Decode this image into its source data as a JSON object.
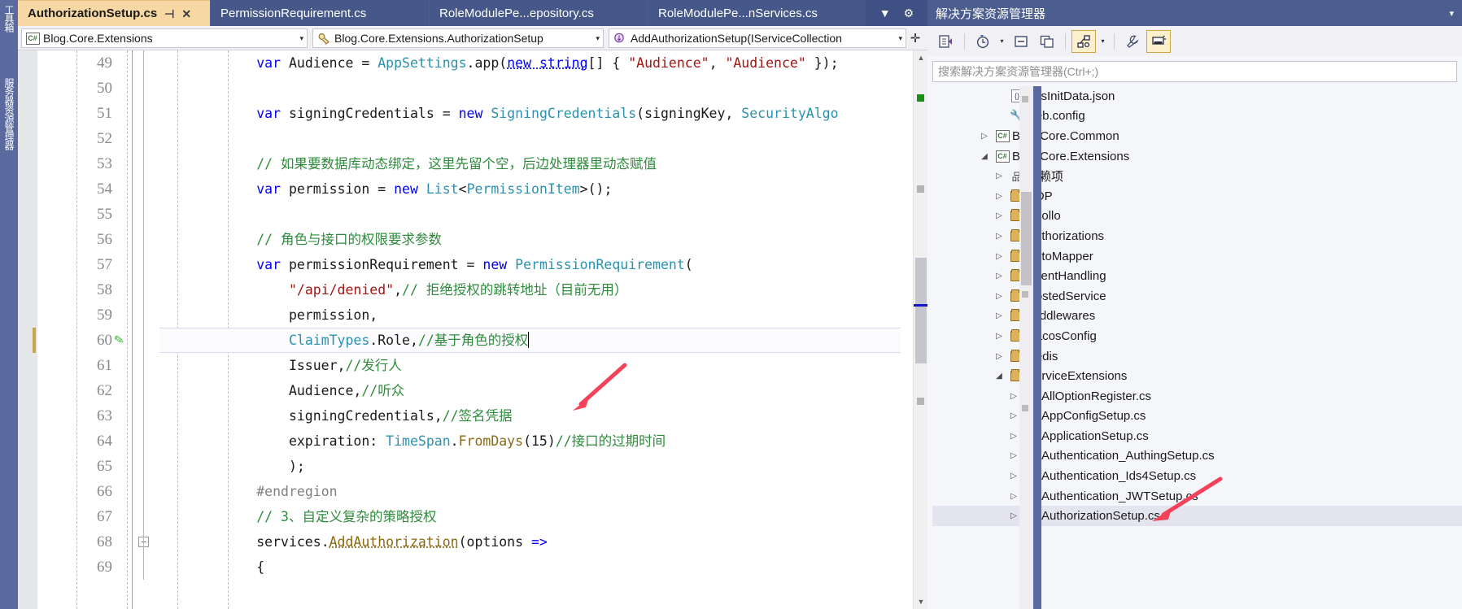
{
  "left_dock": {
    "items": [
      {
        "label": "工具箱",
        "name": "toolbox"
      },
      {
        "label": "服务器资源管理器",
        "name": "server-explorer"
      }
    ]
  },
  "editor": {
    "tabs": [
      {
        "label": "AuthorizationSetup.cs",
        "active": true,
        "pin": "⊣",
        "close": "✕"
      },
      {
        "label": "PermissionRequirement.cs",
        "active": false
      },
      {
        "label": "RoleModulePe...epository.cs",
        "active": false
      },
      {
        "label": "RoleModulePe...nServices.cs",
        "active": false
      }
    ],
    "tabstrip_buttons": [
      {
        "name": "tab-list-dropdown",
        "glyph": "▼"
      },
      {
        "name": "tab-settings-gear",
        "glyph": "⚙"
      }
    ],
    "navbar": {
      "project": "Blog.Core.Extensions",
      "project_icon": "csharp-project-icon",
      "type": "Blog.Core.Extensions.AuthorizationSetup",
      "type_icon": "class-icon",
      "member": "AddAuthorizationSetup(IServiceCollection",
      "member_icon": "method-icon",
      "caret": "▾",
      "split_glyph": "✛"
    },
    "scrollbar": {
      "up_glyph": "▲",
      "down_glyph": "▼"
    },
    "lines": [
      {
        "no": "49",
        "edited": false,
        "tokens": [
          {
            "t": "            ",
            "c": "t-id"
          },
          {
            "t": "var",
            "c": "t-kw"
          },
          {
            "t": " Audience ",
            "c": "t-id"
          },
          {
            "t": "= ",
            "c": "t-id"
          },
          {
            "t": "AppSettings",
            "c": "t-type"
          },
          {
            "t": ".app(",
            "c": "t-id"
          },
          {
            "t": "new string",
            "c": "t-kw t-un"
          },
          {
            "t": "[] { ",
            "c": "t-id"
          },
          {
            "t": "\"Audience\"",
            "c": "t-str"
          },
          {
            "t": ", ",
            "c": "t-id"
          },
          {
            "t": "\"Audience\"",
            "c": "t-str"
          },
          {
            "t": " });",
            "c": "t-id"
          }
        ]
      },
      {
        "no": "50",
        "edited": false,
        "tokens": []
      },
      {
        "no": "51",
        "edited": false,
        "tokens": [
          {
            "t": "            ",
            "c": "t-id"
          },
          {
            "t": "var",
            "c": "t-kw"
          },
          {
            "t": " signingCredentials ",
            "c": "t-id"
          },
          {
            "t": "= ",
            "c": "t-id"
          },
          {
            "t": "new",
            "c": "t-kw"
          },
          {
            "t": " ",
            "c": "t-id"
          },
          {
            "t": "SigningCredentials",
            "c": "t-type"
          },
          {
            "t": "(signingKey, ",
            "c": "t-id"
          },
          {
            "t": "SecurityAlgo",
            "c": "t-type"
          }
        ]
      },
      {
        "no": "52",
        "edited": false,
        "tokens": []
      },
      {
        "no": "53",
        "edited": false,
        "tokens": [
          {
            "t": "            ",
            "c": "t-id"
          },
          {
            "t": "// 如果要数据库动态绑定，这里先留个空，后边处理器里动态赋值",
            "c": "t-cmt"
          }
        ]
      },
      {
        "no": "54",
        "edited": false,
        "tokens": [
          {
            "t": "            ",
            "c": "t-id"
          },
          {
            "t": "var",
            "c": "t-kw"
          },
          {
            "t": " permission ",
            "c": "t-id"
          },
          {
            "t": "= ",
            "c": "t-id"
          },
          {
            "t": "new",
            "c": "t-kw"
          },
          {
            "t": " ",
            "c": "t-id"
          },
          {
            "t": "List",
            "c": "t-type"
          },
          {
            "t": "<",
            "c": "t-id"
          },
          {
            "t": "PermissionItem",
            "c": "t-type"
          },
          {
            "t": ">();",
            "c": "t-id"
          }
        ]
      },
      {
        "no": "55",
        "edited": false,
        "tokens": []
      },
      {
        "no": "56",
        "edited": false,
        "tokens": [
          {
            "t": "            ",
            "c": "t-id"
          },
          {
            "t": "// 角色与接口的权限要求参数",
            "c": "t-cmt"
          }
        ]
      },
      {
        "no": "57",
        "edited": false,
        "tokens": [
          {
            "t": "            ",
            "c": "t-id"
          },
          {
            "t": "var",
            "c": "t-kw"
          },
          {
            "t": " permissionRequirement ",
            "c": "t-id"
          },
          {
            "t": "= ",
            "c": "t-id"
          },
          {
            "t": "new",
            "c": "t-kw"
          },
          {
            "t": " ",
            "c": "t-id"
          },
          {
            "t": "PermissionRequirement",
            "c": "t-type"
          },
          {
            "t": "(",
            "c": "t-id"
          }
        ]
      },
      {
        "no": "58",
        "edited": false,
        "tokens": [
          {
            "t": "                ",
            "c": "t-id"
          },
          {
            "t": "\"/api/denied\"",
            "c": "t-str"
          },
          {
            "t": ",",
            "c": "t-id"
          },
          {
            "t": "// 拒绝授权的跳转地址（目前无用）",
            "c": "t-cmt"
          }
        ]
      },
      {
        "no": "59",
        "edited": false,
        "tokens": [
          {
            "t": "                permission,",
            "c": "t-id"
          }
        ]
      },
      {
        "no": "60",
        "edited": true,
        "current": true,
        "caret": true,
        "tokens": [
          {
            "t": "                ",
            "c": "t-id"
          },
          {
            "t": "ClaimTypes",
            "c": "t-type"
          },
          {
            "t": ".Role,",
            "c": "t-id"
          },
          {
            "t": "//基于角色的授权",
            "c": "t-cmt"
          }
        ]
      },
      {
        "no": "61",
        "edited": false,
        "tokens": [
          {
            "t": "                Issuer,",
            "c": "t-id"
          },
          {
            "t": "//发行人",
            "c": "t-cmt"
          }
        ]
      },
      {
        "no": "62",
        "edited": false,
        "tokens": [
          {
            "t": "                Audience,",
            "c": "t-id"
          },
          {
            "t": "//听众",
            "c": "t-cmt"
          }
        ]
      },
      {
        "no": "63",
        "edited": false,
        "tokens": [
          {
            "t": "                signingCredentials,",
            "c": "t-id"
          },
          {
            "t": "//签名凭据",
            "c": "t-cmt"
          }
        ]
      },
      {
        "no": "64",
        "edited": false,
        "tokens": [
          {
            "t": "                expiration: ",
            "c": "t-id"
          },
          {
            "t": "TimeSpan",
            "c": "t-type"
          },
          {
            "t": ".",
            "c": "t-id"
          },
          {
            "t": "FromDays",
            "c": "t-mem"
          },
          {
            "t": "(",
            "c": "t-id"
          },
          {
            "t": "15",
            "c": "t-num"
          },
          {
            "t": ")",
            "c": "t-id"
          },
          {
            "t": "//接口的过期时间",
            "c": "t-cmt"
          }
        ]
      },
      {
        "no": "65",
        "edited": false,
        "tokens": [
          {
            "t": "                );",
            "c": "t-id"
          }
        ]
      },
      {
        "no": "66",
        "edited": false,
        "tokens": [
          {
            "t": "            ",
            "c": "t-id"
          },
          {
            "t": "#endregion",
            "c": "t-pp"
          }
        ]
      },
      {
        "no": "67",
        "edited": false,
        "tokens": [
          {
            "t": "            ",
            "c": "t-id"
          },
          {
            "t": "// 3、自定义复杂的策略授权",
            "c": "t-cmt"
          }
        ]
      },
      {
        "no": "68",
        "edited": false,
        "fold": "−",
        "tokens": [
          {
            "t": "            services",
            "c": "t-id"
          },
          {
            "t": ".",
            "c": "t-id"
          },
          {
            "t": "AddAuthorization",
            "c": "t-mem t-un"
          },
          {
            "t": "(options ",
            "c": "t-id"
          },
          {
            "t": "=>",
            "c": "t-kw"
          }
        ]
      },
      {
        "no": "69",
        "edited": false,
        "tokens": [
          {
            "t": "            {",
            "c": "t-id"
          }
        ]
      }
    ]
  },
  "solution_explorer": {
    "title": "解决方案资源管理器",
    "title_caret": "▾",
    "toolbar": [
      {
        "name": "home-view-button",
        "glyph": "⊲",
        "hot": false
      },
      {
        "name": "pending-changes-button",
        "glyph": "◔",
        "hot": false,
        "caret": true
      },
      {
        "name": "collapse-all-button",
        "glyph": "⊟",
        "hot": false
      },
      {
        "name": "show-all-files-button",
        "glyph": "❐",
        "hot": false
      },
      {
        "name": "view-selector-button",
        "glyph": "⚯",
        "hot": true,
        "caret": true
      },
      {
        "name": "properties-button",
        "glyph": "🔧",
        "hot": false
      },
      {
        "name": "preview-selected-items-button",
        "glyph": "▤",
        "hot": true
      }
    ],
    "search_placeholder": "搜索解决方案资源管理器(Ctrl+;)",
    "tree": [
      {
        "label": "SysInitData.json",
        "icon": "json-file-icon",
        "indent": 4,
        "expander": ""
      },
      {
        "label": "web.config",
        "icon": "config-file-icon",
        "indent": 4,
        "expander": ""
      },
      {
        "label": "Blog.Core.Common",
        "icon": "csharp-project-icon",
        "indent": 3,
        "expander": "▷"
      },
      {
        "label": "Blog.Core.Extensions",
        "icon": "csharp-project-icon",
        "indent": 3,
        "expander": "◢"
      },
      {
        "label": "依赖项",
        "icon": "dependencies-icon",
        "indent": 4,
        "expander": "▷"
      },
      {
        "label": "AOP",
        "icon": "folder-icon",
        "indent": 4,
        "expander": "▷"
      },
      {
        "label": "Apollo",
        "icon": "folder-icon",
        "indent": 4,
        "expander": "▷"
      },
      {
        "label": "Authorizations",
        "icon": "folder-icon",
        "indent": 4,
        "expander": "▷"
      },
      {
        "label": "AutoMapper",
        "icon": "folder-icon",
        "indent": 4,
        "expander": "▷"
      },
      {
        "label": "EventHandling",
        "icon": "folder-icon",
        "indent": 4,
        "expander": "▷"
      },
      {
        "label": "HostedService",
        "icon": "folder-icon",
        "indent": 4,
        "expander": "▷"
      },
      {
        "label": "Middlewares",
        "icon": "folder-icon",
        "indent": 4,
        "expander": "▷"
      },
      {
        "label": "NacosConfig",
        "icon": "folder-icon",
        "indent": 4,
        "expander": "▷"
      },
      {
        "label": "Redis",
        "icon": "folder-icon",
        "indent": 4,
        "expander": "▷"
      },
      {
        "label": "ServiceExtensions",
        "icon": "folder-icon",
        "indent": 4,
        "expander": "◢"
      },
      {
        "label": "AllOptionRegister.cs",
        "icon": "csharp-file-icon",
        "indent": 5,
        "expander": "▷"
      },
      {
        "label": "AppConfigSetup.cs",
        "icon": "csharp-file-icon",
        "indent": 5,
        "expander": "▷"
      },
      {
        "label": "ApplicationSetup.cs",
        "icon": "csharp-file-icon",
        "indent": 5,
        "expander": "▷"
      },
      {
        "label": "Authentication_AuthingSetup.cs",
        "icon": "csharp-file-icon",
        "indent": 5,
        "expander": "▷"
      },
      {
        "label": "Authentication_Ids4Setup.cs",
        "icon": "csharp-file-icon",
        "indent": 5,
        "expander": "▷"
      },
      {
        "label": "Authentication_JWTSetup.cs",
        "icon": "csharp-file-icon",
        "indent": 5,
        "expander": "▷"
      },
      {
        "label": "AuthorizationSetup.cs",
        "icon": "csharp-file-icon",
        "indent": 5,
        "expander": "▷",
        "selected": true
      }
    ]
  },
  "annotations": {
    "arrow_color": "#f4425a",
    "arrows": [
      {
        "name": "arrow-to-signing-credentials-comment"
      },
      {
        "name": "arrow-to-authorization-setup-file"
      }
    ]
  }
}
